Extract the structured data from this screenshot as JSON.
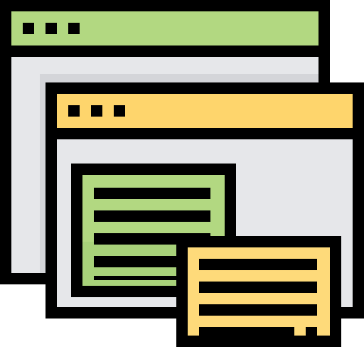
{
  "icon": {
    "subject": "multiple-windows-icon",
    "colors": {
      "outline": "#000000",
      "green": "#b2d881",
      "green_light": "#a8d27a",
      "yellow": "#fed56c",
      "yellow_light": "#ffe08c",
      "gray": "#e6e7ea",
      "gray_shadow": "#d4d5d9"
    },
    "back_window": {
      "titlebar_dots": 3
    },
    "front_window": {
      "titlebar_dots": 3
    },
    "green_panel": {
      "text_lines": 5
    },
    "yellow_panel": {
      "text_lines": 4
    }
  }
}
